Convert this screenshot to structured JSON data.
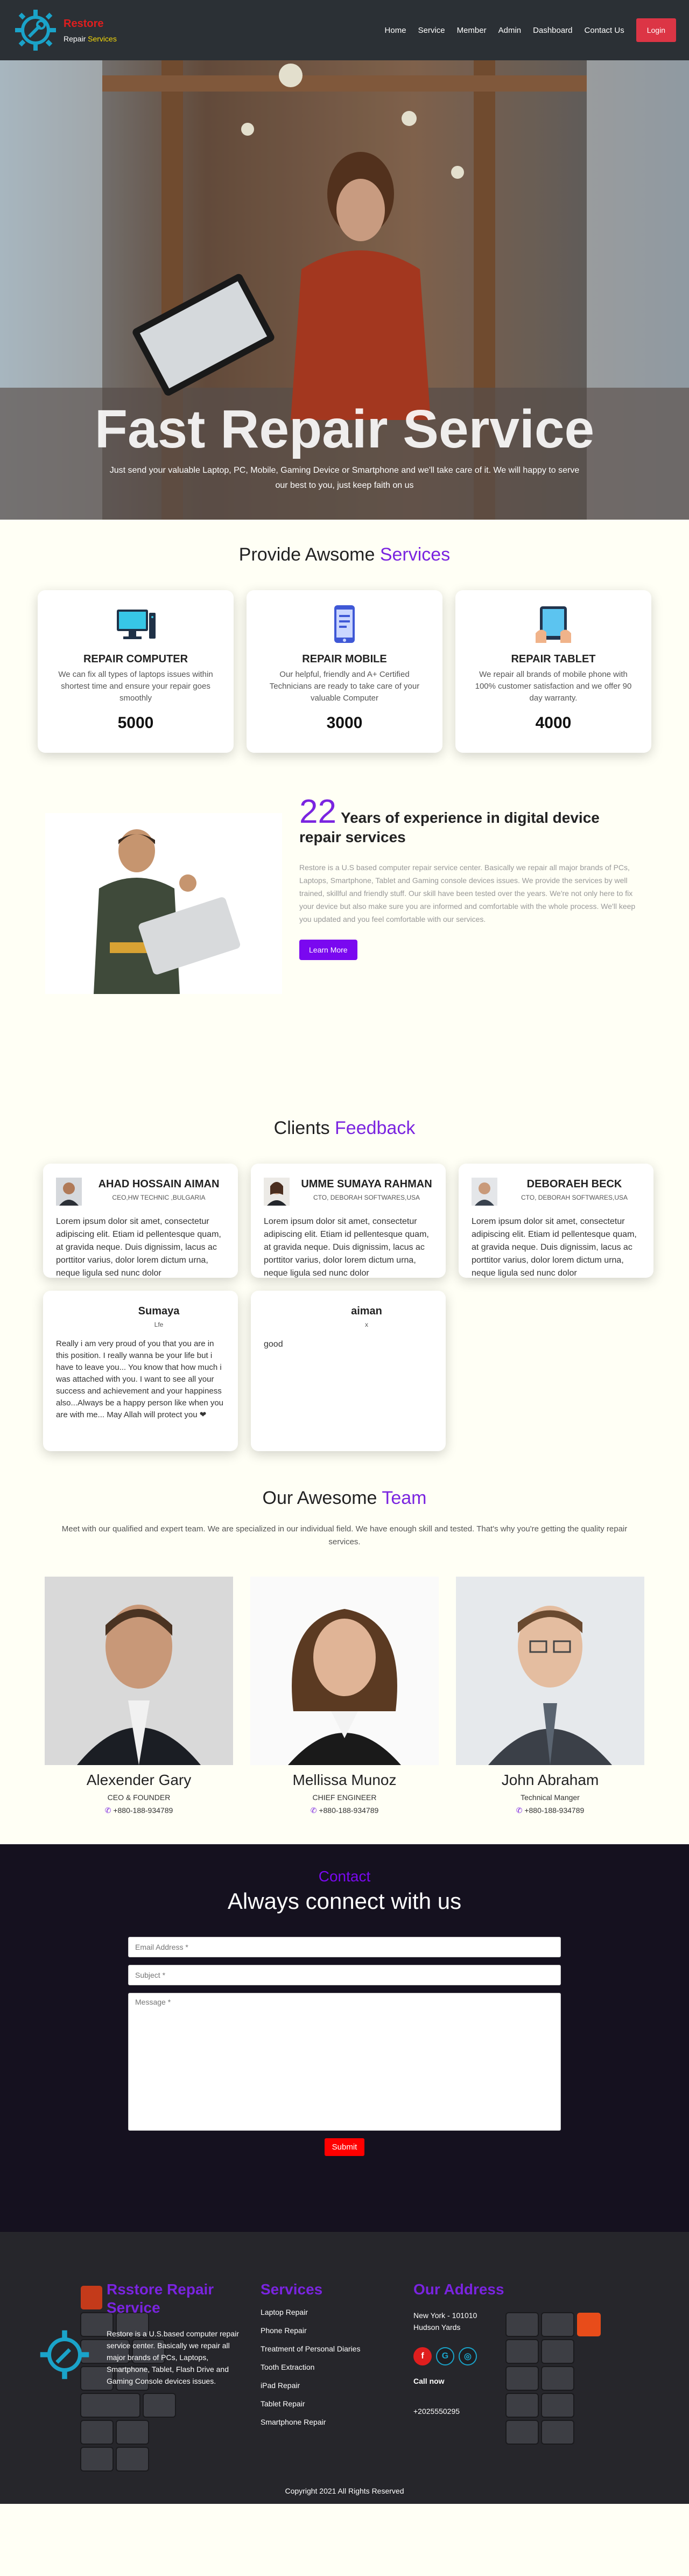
{
  "nav": {
    "brand": "Restore",
    "tagline_a": "Repair",
    "tagline_b": "Services",
    "items": [
      "Home",
      "Service",
      "Member",
      "Admin",
      "Dashboard",
      "Contact Us"
    ],
    "login": "Login"
  },
  "hero": {
    "title": "Fast Repair Service",
    "subtitle": "Just send your valuable Laptop, PC, Mobile, Gaming Device or Smartphone and we'll take care of it. We will happy to serve our best to you, just keep faith on us"
  },
  "services": {
    "title_a": "Provide Awsome",
    "title_b": "Services",
    "cards": [
      {
        "name": "REPAIR COMPUTER",
        "desc": "We can fix all types of laptops issues within shortest time and ensure your repair goes smoothly",
        "count": "5000",
        "icon": "computer-icon"
      },
      {
        "name": "REPAIR MOBILE",
        "desc": "Our helpful, friendly and A+ Certified Technicians are ready to take care of your valuable Computer",
        "count": "3000",
        "icon": "mobile-icon"
      },
      {
        "name": "REPAIR TABLET",
        "desc": "We repair all brands of mobile phone with 100% customer satisfaction and we offer 90 day warranty.",
        "count": "4000",
        "icon": "tablet-icon"
      }
    ]
  },
  "about": {
    "years": "22",
    "heading": "Years of experience in digital device repair services",
    "text": "Restore is a U.S based computer repair service center. Basically we repair all major brands of PCs, Laptops, Smartphone, Tablet and Gaming console devices issues. We provide the services by well trained, skillful and friendly stuff. Our skill have been tested over the years. We're not only here to fix your device but also make sure you are informed and comfortable with the whole process. We'll keep you updated and you feel comfortable with our services.",
    "button": "Learn More"
  },
  "feedback": {
    "title_a": "Clients",
    "title_b": "Feedback",
    "items": [
      {
        "name": "AHAD HOSSAIN AIMAN",
        "role": "CEO,HW TECHNIC ,BULGARIA",
        "text": "Lorem ipsum dolor sit amet, consectetur adipiscing elit. Etiam id pellentesque quam, at gravida neque. Duis dignissim, lacus ac porttitor varius, dolor lorem dictum urna, neque ligula sed nunc dolor"
      },
      {
        "name": "UMME SUMAYA RAHMAN",
        "role": "CTO, DEBORAH SOFTWARES,USA",
        "text": "Lorem ipsum dolor sit amet, consectetur adipiscing elit. Etiam id pellentesque quam, at gravida neque. Duis dignissim, lacus ac porttitor varius, dolor lorem dictum urna, neque ligula sed nunc dolor"
      },
      {
        "name": "DEBORAEH BECK",
        "role": "CTO, DEBORAH SOFTWARES,USA",
        "text": "Lorem ipsum dolor sit amet, consectetur adipiscing elit. Etiam id pellentesque quam, at gravida neque. Duis dignissim, lacus ac porttitor varius, dolor lorem dictum urna, neque ligula sed nunc dolor"
      },
      {
        "name": "Sumaya",
        "role": "Lfe",
        "text": "Really i am very proud of you that you are in this position. I really wanna be your life but i have to leave you... You know that how much i was attached with you. I want to see all your success and achievement and your happiness also...Always be a happy person like when you are with me... May Allah will protect you ❤"
      },
      {
        "name": "aiman",
        "role": "x",
        "text": "good"
      }
    ]
  },
  "team": {
    "title_a": "Our Awesome",
    "title_b": "Team",
    "lead": "Meet with our qualified and expert team. We are specialized in our individual field. We have enough skill and tested. That's why you're getting the quality repair services.",
    "members": [
      {
        "name": "Alexender Gary",
        "role": "CEO & FOUNDER",
        "phone": "+880-188-934789"
      },
      {
        "name": "Mellissa Munoz",
        "role": "CHIEF ENGINEER",
        "phone": "+880-188-934789"
      },
      {
        "name": "John Abraham",
        "role": "Technical Manger",
        "phone": "+880-188-934789"
      }
    ]
  },
  "contact": {
    "kicker": "Contact",
    "title": "Always connect with us",
    "email_ph": "Email Address *",
    "subject_ph": "Subject *",
    "message_ph": "Message *",
    "submit": "Submit"
  },
  "footer": {
    "col1_title": "Rsstore Repair Service",
    "col1_text": "Restore is a U.S.based computer repair service center. Basically we repair all major brands of PCs, Laptops, Smartphone, Tablet, Flash Drive and Gaming Console devices issues.",
    "col2_title": "Services",
    "col2_items": [
      "Laptop Repair",
      "Phone Repair",
      "Treatment of Personal Diaries",
      "Tooth Extraction",
      "iPad Repair",
      "Tablet Repair",
      "Smartphone Repair"
    ],
    "col3_title": "Our Address",
    "address": "New York - 101010 Hudson Yards",
    "call_label": "Call now",
    "phone": "+2025550295",
    "copyright": "Copyright 2021 All Rights Reserved"
  }
}
